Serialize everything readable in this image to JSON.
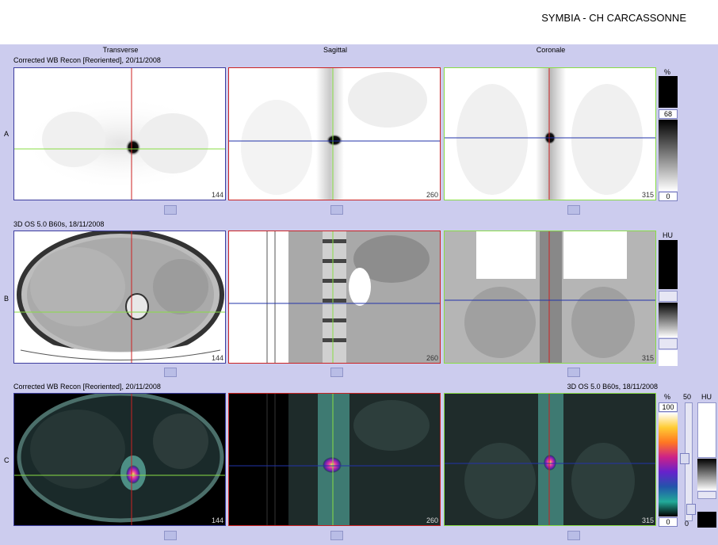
{
  "header": {
    "title": "SYMBIA - CH CARCASSONNE"
  },
  "columns": {
    "transverse": "Transverse",
    "sagittal": "Sagittal",
    "coronal": "Coronale"
  },
  "rows": {
    "a": {
      "letter": "A",
      "caption": "Corrected WB Recon [Reoriented], 20/11/2008"
    },
    "b": {
      "letter": "B",
      "caption": "3D  OS  5.0  B60s, 18/11/2008"
    },
    "c": {
      "letter": "C",
      "caption": "Corrected WB Recon [Reoriented], 20/11/2008",
      "caption_right": "3D  OS  5.0  B60s, 18/11/2008"
    }
  },
  "slices": {
    "transverse": "144",
    "sagittal": "260",
    "coronal": "315"
  },
  "colorbars": {
    "a": {
      "unit": "%",
      "max": "68",
      "min": "0"
    },
    "b": {
      "unit": "HU"
    },
    "c": {
      "unit_pet": "%",
      "max": "100",
      "min": "0",
      "fusion": "50",
      "fusion_min": "0",
      "unit_ct": "HU"
    }
  },
  "colors": {
    "transverse_border": "#3d3d9e",
    "sagittal_border": "#cc2222",
    "coronal_border": "#88dd44",
    "background": "#ccccee"
  }
}
